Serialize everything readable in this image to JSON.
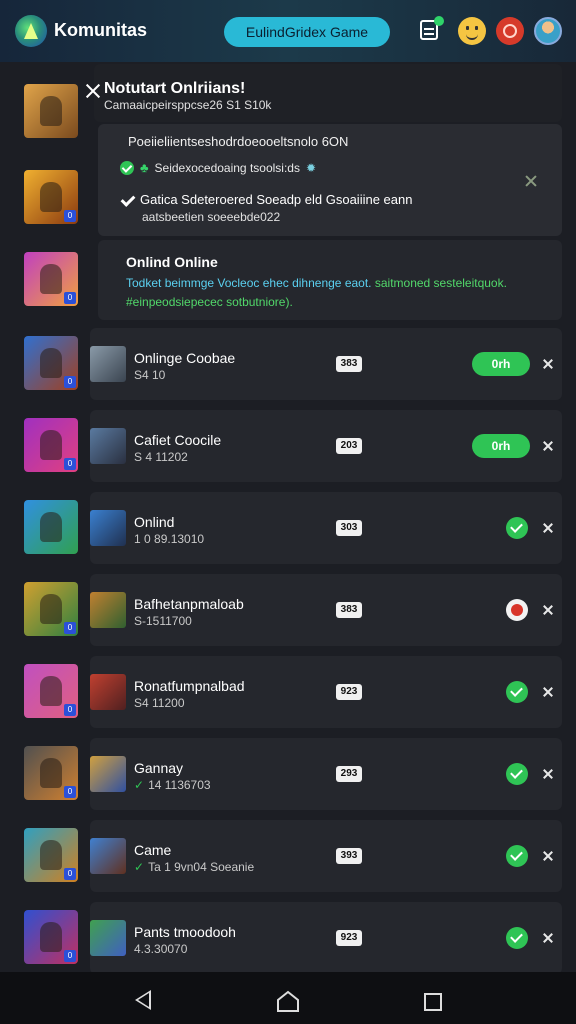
{
  "header": {
    "app_title": "Komunitas",
    "game_button": "EulindGridex Game"
  },
  "popup": {
    "title": "Notutart Onlriians!",
    "subtitle": "Camaaicpeirsppcse26 S1 S10k",
    "notice_head": "Poeiieliientseshodrdoeooeltsnolo 6ON",
    "notice_line1": "Seidexocedoaing tsoolsi:ds",
    "notice_line2": "Gatica Sdeteroered Soeadp eld Gsoaiiine eann",
    "notice_line3": "aatsbeetien soeeebde022",
    "online_title": "Onlind Online",
    "online_desc_blue": "Todket beimmge Vocleoc ehec dihnenge eaot.",
    "online_desc_green": "saitmoned sesteleitquok. #einpeodsiepecec sotbutniore)."
  },
  "rows": [
    {
      "name": "Onlinge Coobae",
      "meta": "S4 10",
      "badge": "383",
      "status": "on",
      "status_label": "0rh"
    },
    {
      "name": "Cafiet Coocile",
      "meta": "S 4 11202",
      "badge": "203",
      "status": "on",
      "status_label": "0rh"
    },
    {
      "name": "Onlind",
      "meta": "1 0 89.13010",
      "badge": "303",
      "status": "ok"
    },
    {
      "name": "Bafhetanpmaloab",
      "meta": "S-1511700",
      "badge": "383",
      "status": "warn"
    },
    {
      "name": "Ronatfumpnalbad",
      "meta": "S4 11200",
      "badge": "923",
      "status": "ok"
    },
    {
      "name": "Gannay",
      "meta": "14 1136703",
      "badge": "293",
      "status": "ok",
      "check": true
    },
    {
      "name": "Came",
      "meta": "Ta 1 9vn04 Soeanie",
      "badge": "393",
      "status": "ok",
      "check": true
    },
    {
      "name": "Pants tmoodooh",
      "meta": "4.3.30070",
      "badge": "923",
      "status": "ok"
    }
  ],
  "icons": {
    "logo": "game-logo-icon",
    "notes": "notes-icon",
    "emoji": "smile-icon",
    "alert": "alert-icon",
    "avatar": "avatar-icon"
  },
  "colors": {
    "accent": "#29b9d6",
    "online_green": "#2fc455",
    "warning_red": "#d8352a"
  }
}
